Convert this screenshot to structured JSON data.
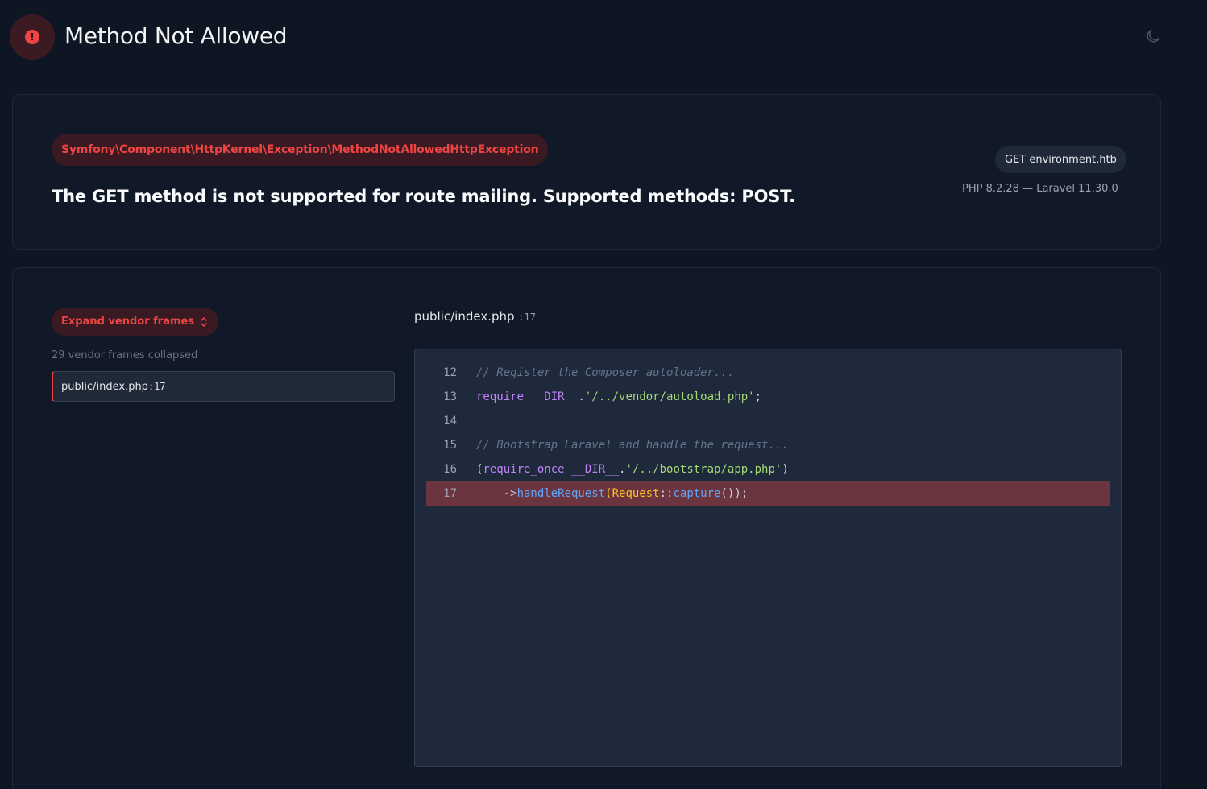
{
  "header": {
    "title": "Method Not Allowed",
    "error_icon": "exclamation-circle-icon",
    "theme_icon": "moon-icon"
  },
  "exception": {
    "class": "Symfony\\Component\\HttpKernel\\Exception\\MethodNotAllowedHttpException",
    "message": "The GET method is not supported for route mailing. Supported methods: POST.",
    "request": "GET environment.htb",
    "versions": "PHP 8.2.28 — Laravel 11.30.0"
  },
  "trace": {
    "expand_label": "Expand vendor frames",
    "vendor_count": "29 vendor frames collapsed",
    "frames": [
      {
        "file": "public/index.php",
        "line": ":17"
      }
    ]
  },
  "code": {
    "file": "public/index.php",
    "line": ":17",
    "lines": [
      {
        "no": "12",
        "comment": "// Register the Composer autoloader..."
      },
      {
        "no": "13",
        "kw": "require",
        "const": " __DIR__",
        "dot": ".",
        "str": "'/../vendor/autoload.php'",
        "end": ";"
      },
      {
        "no": "14"
      },
      {
        "no": "15",
        "comment": "// Bootstrap Laravel and handle the request..."
      },
      {
        "no": "16",
        "open": "(",
        "kw": "require_once",
        "const": " __DIR__",
        "dot": ".",
        "str": "'/../bootstrap/app.php'",
        "close": ")"
      },
      {
        "no": "17",
        "arrow": "    ->",
        "fn": "handleRequest",
        "p1": "(",
        "cls": "Request",
        "sep": "::",
        "fn2": "capture",
        "end": "());"
      }
    ]
  },
  "colors": {
    "background": "#0f1623",
    "accent": "#ef4444",
    "highlight": "#6b3540"
  }
}
